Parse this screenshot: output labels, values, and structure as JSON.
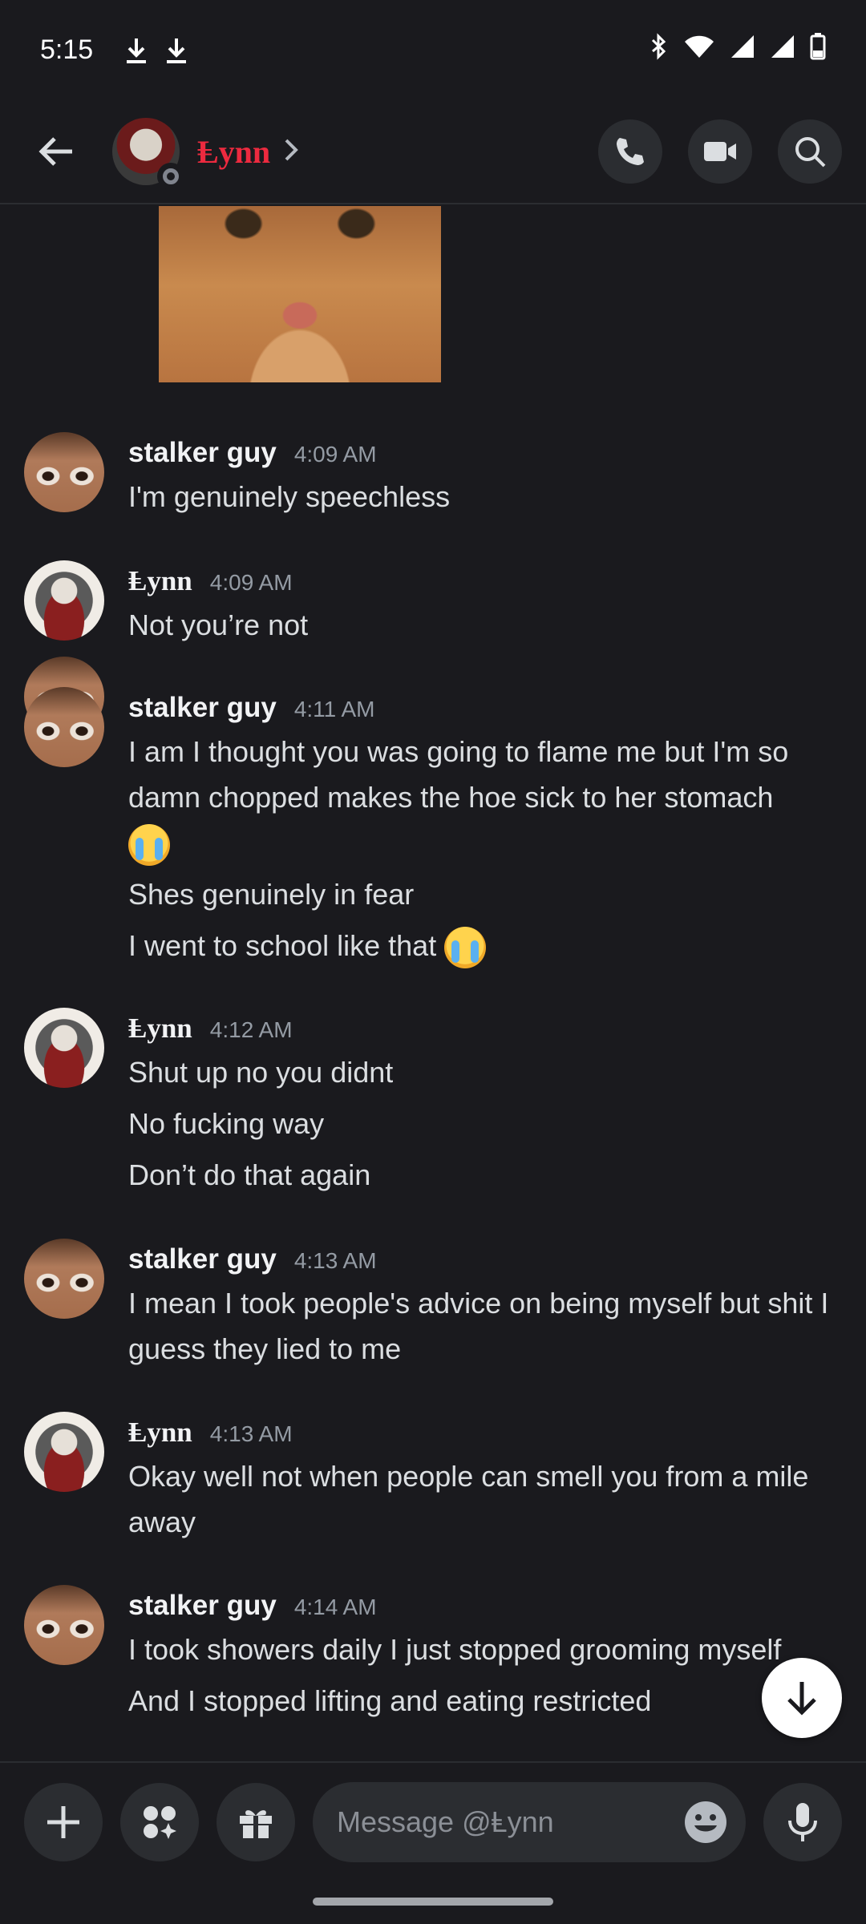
{
  "status_bar": {
    "time": "5:15"
  },
  "header": {
    "name": "Ⱡynn"
  },
  "composer": {
    "placeholder": "Message @Ⱡynn"
  },
  "messages": [
    {
      "author": "stalker guy",
      "time": "4:09 AM",
      "lines": [
        "I'm genuinely speechless"
      ]
    },
    {
      "author": "Ⱡynn",
      "time": "4:09 AM",
      "lines": [
        "Not you’re not"
      ]
    },
    {
      "author": "stalker guy",
      "time": "4:11 AM",
      "lines": [
        "I am I thought you was going to flame me but I'm so damn chopped makes the hoe sick to her stomach",
        "Shes genuinely in fear",
        "I went to school like that"
      ]
    },
    {
      "author": "Ⱡynn",
      "time": "4:12 AM",
      "lines": [
        "Shut up no you didnt",
        "No fucking way",
        "Don’t do that again"
      ]
    },
    {
      "author": "stalker guy",
      "time": "4:13 AM",
      "lines": [
        "I mean I took people's advice on being myself but shit I guess they lied to me"
      ]
    },
    {
      "author": "Ⱡynn",
      "time": "4:13 AM",
      "lines": [
        "Okay well not when people can smell you from a mile away"
      ]
    },
    {
      "author": "stalker guy",
      "time": "4:14 AM",
      "lines": [
        "I took showers daily I just stopped grooming myself",
        "And I stopped lifting and eating restricted"
      ]
    }
  ],
  "colors": {
    "background": "#1a1a1e",
    "accent_name": "#ed2a3f",
    "timestamp": "#949ba4"
  }
}
